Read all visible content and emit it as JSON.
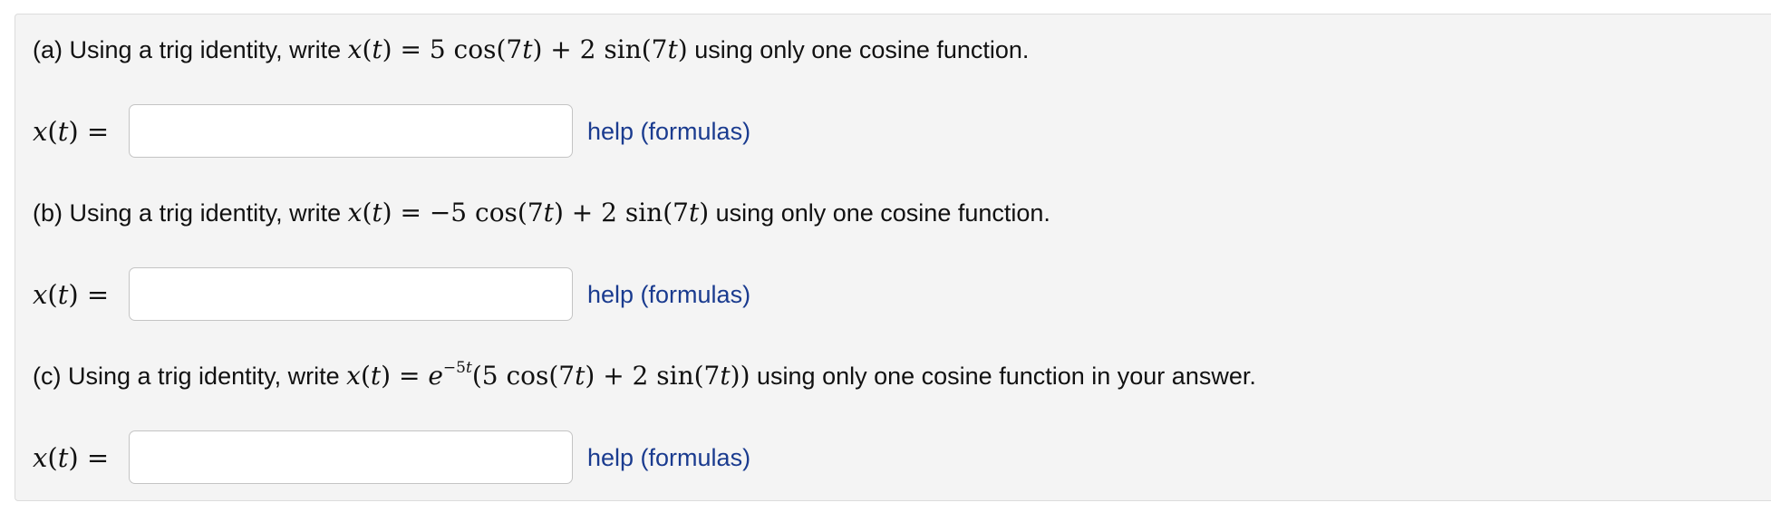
{
  "help_link_label": "help (formulas)",
  "answer_lhs": "x(t) =",
  "parts": [
    {
      "label": "(a)",
      "prefix": "Using a trig identity, write",
      "formula": "x(t) = 5 cos(7t) + 2 sin(7t)",
      "suffix": "using only one cosine function.",
      "answer_value": ""
    },
    {
      "label": "(b)",
      "prefix": "Using a trig identity, write",
      "formula": "x(t) = −5 cos(7t) + 2 sin(7t)",
      "suffix": "using only one cosine function.",
      "answer_value": ""
    },
    {
      "label": "(c)",
      "prefix": "Using a trig identity, write",
      "formula": "x(t) = e^(−5t)(5 cos(7t) + 2 sin(7t))",
      "suffix": "using only one cosine function in your answer.",
      "answer_value": ""
    }
  ]
}
